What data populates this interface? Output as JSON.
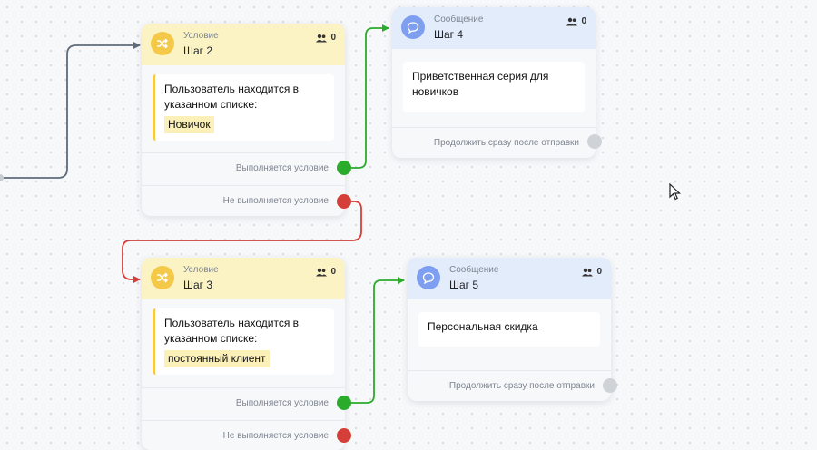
{
  "colors": {
    "condition_header": "#fbf3c4",
    "message_header": "#e3ecfb",
    "yes_port": "#2bab2b",
    "no_port": "#d43f3a",
    "idle_port": "#cfd3d8",
    "entry_link": "#5f6b7a"
  },
  "nodes": {
    "step2": {
      "type": "Условие",
      "title": "Шаг 2",
      "count": "0",
      "icon": "shuffle-icon",
      "text": "Пользователь находится в указанном списке:",
      "tag": "Новичок",
      "yes_label": "Выполняется условие",
      "no_label": "Не выполняется условие"
    },
    "step3": {
      "type": "Условие",
      "title": "Шаг 3",
      "count": "0",
      "icon": "shuffle-icon",
      "text": "Пользователь находится в указанном списке:",
      "tag": "постоянный клиент",
      "yes_label": "Выполняется условие",
      "no_label": "Не выполняется условие"
    },
    "step4": {
      "type": "Сообщение",
      "title": "Шаг 4",
      "count": "0",
      "icon": "chat-bubble-icon",
      "text": "Приветственная серия для новичков",
      "continue_label": "Продолжить сразу после отправки"
    },
    "step5": {
      "type": "Сообщение",
      "title": "Шаг 5",
      "count": "0",
      "icon": "chat-bubble-icon",
      "text": "Персональная скидка",
      "continue_label": "Продолжить сразу после отправки"
    }
  }
}
